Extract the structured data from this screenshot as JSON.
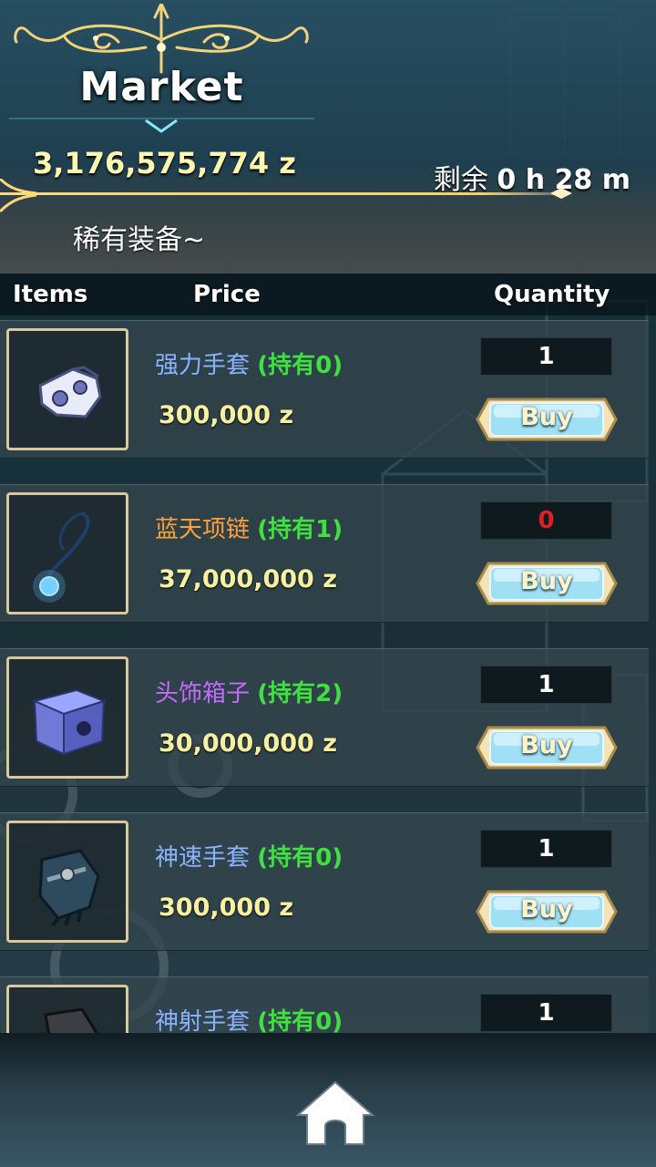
{
  "header": {
    "title": "Market",
    "money": "3,176,575,774 z",
    "timer_prefix": "剩余",
    "timer_value": "0 h 28 m",
    "subtitle": "稀有装备~"
  },
  "columns": {
    "items": "Items",
    "price": "Price",
    "quantity": "Quantity"
  },
  "buy_label": "Buy",
  "items": [
    {
      "name": "强力手套",
      "name_color": "#8ab4ff",
      "owned": "(持有0)",
      "price": "300,000 z",
      "quantity": "1",
      "icon": "gauntlet-icon"
    },
    {
      "name": "蓝天项链",
      "name_color": "#ffa13a",
      "owned": "(持有1)",
      "price": "37,000,000 z",
      "quantity": "0",
      "icon": "necklace-icon"
    },
    {
      "name": "头饰箱子",
      "name_color": "#c56cff",
      "owned": "(持有2)",
      "price": "30,000,000 z",
      "quantity": "1",
      "icon": "box-icon"
    },
    {
      "name": "神速手套",
      "name_color": "#8ab4ff",
      "owned": "(持有0)",
      "price": "300,000 z",
      "quantity": "1",
      "icon": "glove-icon"
    },
    {
      "name": "神射手套",
      "name_color": "#8ab4ff",
      "owned": "(持有0)",
      "price": "",
      "quantity": "1",
      "icon": "glove-dark-icon"
    }
  ],
  "colors": {
    "owned": "#3fe03f",
    "price": "#f6f0a0",
    "gold": "#e8c86a",
    "quantity_zero": "#e02020"
  },
  "nav": {
    "home_icon": "home-icon"
  }
}
